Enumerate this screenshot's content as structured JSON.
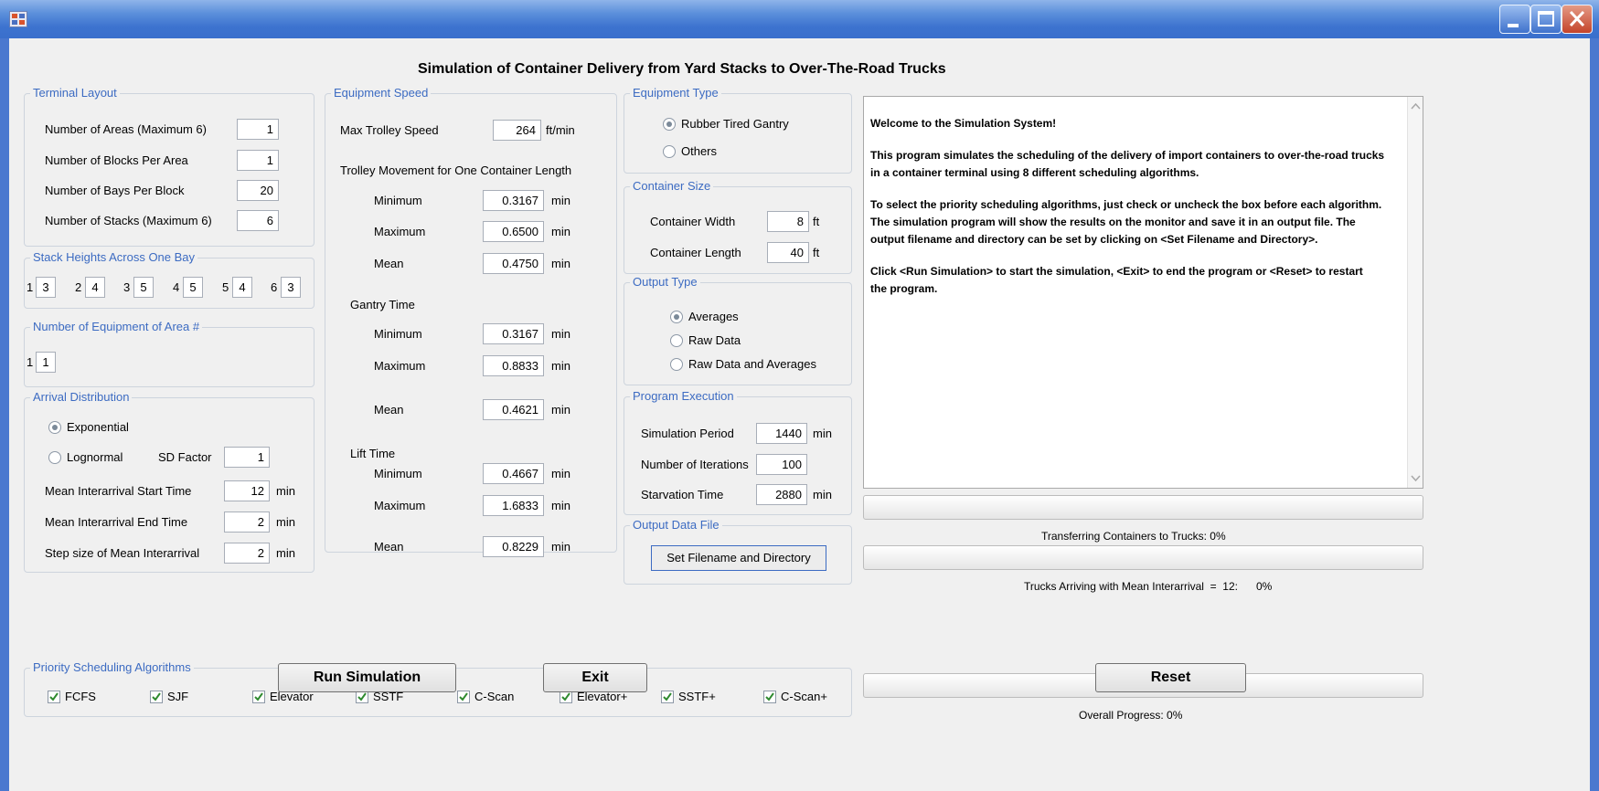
{
  "window": {
    "title": "",
    "colors": {
      "title_bar": "#3d73cf",
      "legend": "#3c6bc2",
      "progress_fill": "#38b048"
    }
  },
  "header": {
    "title": "Simulation of Container Delivery from Yard Stacks to Over-The-Road Trucks"
  },
  "terminal_layout": {
    "legend": "Terminal Layout",
    "areas_label": "Number of Areas (Maximum 6)",
    "areas_value": "1",
    "blocks_label": "Number of Blocks Per Area",
    "blocks_value": "1",
    "bays_label": "Number of Bays Per Block",
    "bays_value": "20",
    "stacks_label": "Number of Stacks (Maximum 6)",
    "stacks_value": "6"
  },
  "stack_heights": {
    "legend": "Stack Heights Across One Bay",
    "items": [
      {
        "index": "1",
        "value": "3"
      },
      {
        "index": "2",
        "value": "4"
      },
      {
        "index": "3",
        "value": "5"
      },
      {
        "index": "4",
        "value": "5"
      },
      {
        "index": "5",
        "value": "4"
      },
      {
        "index": "6",
        "value": "3"
      }
    ]
  },
  "equipment_area": {
    "legend": "Number of Equipment of Area #",
    "index": "1",
    "value": "1"
  },
  "arrival": {
    "legend": "Arrival Distribution",
    "exponential": "Exponential",
    "exponential_selected": true,
    "lognormal": "Lognormal",
    "lognormal_selected": false,
    "sd_label": "SD Factor",
    "sd_value": "1",
    "start_label": "Mean Interarrival Start Time",
    "start_value": "12",
    "start_unit": "min",
    "end_label": "Mean Interarrival End Time",
    "end_value": "2",
    "end_unit": "min",
    "step_label": "Step size of Mean Interarrival",
    "step_value": "2",
    "step_unit": "min"
  },
  "equipment_speed": {
    "legend": "Equipment Speed",
    "trolley_label": "Max Trolley Speed",
    "trolley_value": "264",
    "trolley_unit": "ft/min",
    "movement_label": "Trolley Movement for One Container Length",
    "movement_min_label": "Minimum",
    "movement_min": "0.3167",
    "movement_max_label": "Maximum",
    "movement_max": "0.6500",
    "movement_mean_label": "Mean",
    "movement_mean": "0.4750",
    "gantry_label": "Gantry Time",
    "gantry_min_label": "Minimum",
    "gantry_min": "0.3167",
    "gantry_max_label": "Maximum",
    "gantry_max": "0.8833",
    "gantry_mean_label": "Mean",
    "gantry_mean": "0.4621",
    "lift_label": "Lift Time",
    "lift_min_label": "Minimum",
    "lift_min": "0.4667",
    "lift_max_label": "Maximum",
    "lift_max": "1.6833",
    "lift_mean_label": "Mean",
    "lift_mean": "0.8229",
    "unit": "min"
  },
  "equipment_type": {
    "legend": "Equipment Type",
    "rtg": "Rubber Tired Gantry",
    "rtg_selected": true,
    "others": "Others",
    "others_selected": false
  },
  "container_size": {
    "legend": "Container Size",
    "width_label": "Container Width",
    "width_value": "8",
    "length_label": "Container Length",
    "length_value": "40",
    "unit": "ft"
  },
  "output_type": {
    "legend": "Output Type",
    "averages": "Averages",
    "averages_selected": true,
    "raw": "Raw Data",
    "raw_selected": false,
    "raw_avg": "Raw Data and Averages",
    "raw_avg_selected": false
  },
  "program_execution": {
    "legend": "Program Execution",
    "period_label": "Simulation Period",
    "period_value": "1440",
    "period_unit": "min",
    "iterations_label": "Number of Iterations",
    "iterations_value": "100",
    "starvation_label": "Starvation Time",
    "starvation_value": "2880",
    "starvation_unit": "min"
  },
  "output_file": {
    "legend": "Output Data File",
    "button": "Set Filename and Directory"
  },
  "algorithms": {
    "legend": "Priority Scheduling Algorithms",
    "items": [
      {
        "label": "FCFS",
        "checked": true
      },
      {
        "label": "SJF",
        "checked": true
      },
      {
        "label": "Elevator",
        "checked": true
      },
      {
        "label": "SSTF",
        "checked": true
      },
      {
        "label": "C-Scan",
        "checked": true
      },
      {
        "label": "Elevator+",
        "checked": true
      },
      {
        "label": "SSTF+",
        "checked": true
      },
      {
        "label": "C-Scan+",
        "checked": true
      }
    ]
  },
  "message": {
    "lines": [
      "Welcome to the Simulation System!",
      "This program simulates the scheduling of the delivery of import containers to over-the-road trucks",
      "in a container terminal using 8 different scheduling algorithms.",
      "To select the priority scheduling algorithms, just check or uncheck the box before each algorithm.",
      "The simulation program will show the results on the monitor and save it in an output file. The",
      "output filename and directory can be set by clicking on <Set Filename and Directory>.",
      "Click <Run Simulation> to start the simulation, <Exit> to end the program or <Reset> to restart",
      "the program."
    ]
  },
  "progress": {
    "transfer_label": "Transferring Containers to Trucks:  0%",
    "transfer_value": 0,
    "arrival_label": "Trucks Arriving with Mean Interarrival  =  12:      0%",
    "arrival_value": 0,
    "overall_label": "Overall Progress:  0%",
    "overall_value": 0
  },
  "buttons": {
    "run": "Run Simulation",
    "exit": "Exit",
    "reset": "Reset"
  }
}
